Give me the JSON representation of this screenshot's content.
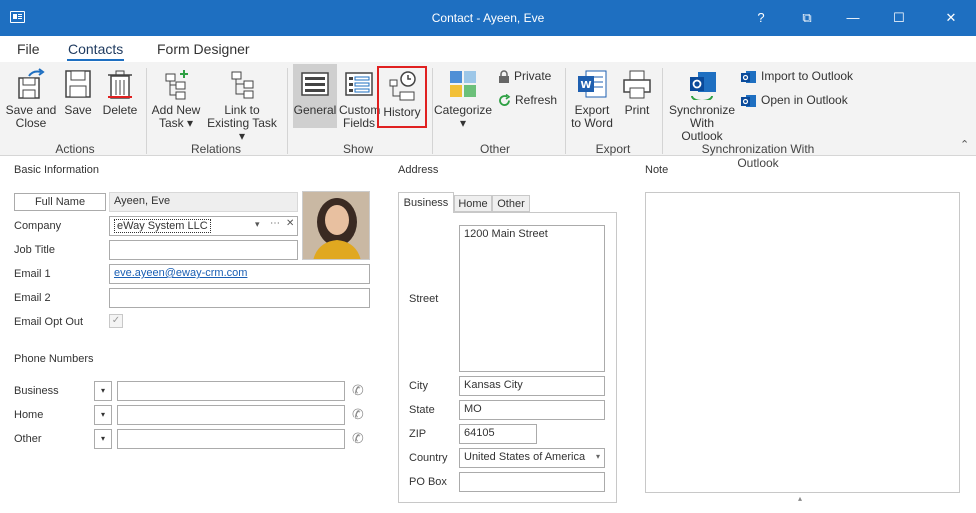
{
  "window": {
    "title": "Contact - Ayeen, Eve",
    "help_glyph": "?",
    "restore_glyph": "⧉",
    "minimize_glyph": "—",
    "maximize_glyph": "☐",
    "close_glyph": "✕"
  },
  "menu": {
    "file": "File",
    "contacts": "Contacts",
    "form_designer": "Form Designer"
  },
  "ribbon": {
    "save_and_close": [
      "Save and",
      "Close"
    ],
    "save": "Save",
    "delete": "Delete",
    "add_new_task": [
      "Add New",
      "Task ▾"
    ],
    "link_existing": [
      "Link to",
      "Existing Task ▾"
    ],
    "general": "General",
    "custom_fields": [
      "Custom",
      "Fields"
    ],
    "history": "History",
    "categorize": "Categorize",
    "private": "Private",
    "refresh": "Refresh",
    "export_word": [
      "Export",
      "to Word"
    ],
    "print": "Print",
    "sync_outlook": [
      "Synchronize",
      "With Outlook"
    ],
    "import_outlook": "Import to Outlook",
    "open_outlook": "Open in Outlook",
    "groups": {
      "actions": "Actions",
      "relations": "Relations",
      "show": "Show",
      "other": "Other",
      "export": "Export",
      "sync": "Synchronization With Outlook"
    },
    "collapse_glyph": "⌃",
    "dropdown_glyph": "▾"
  },
  "basic": {
    "section": "Basic Information",
    "full_name_btn": "Full Name",
    "full_name": "Ayeen, Eve",
    "company_label": "Company",
    "company": "eWay System LLC",
    "company_buttons": [
      "▾",
      "⋯",
      "✕"
    ],
    "job_title_label": "Job Title",
    "job_title": "",
    "email1_label": "Email 1",
    "email1": "eve.ayeen@eway-crm.com",
    "email2_label": "Email 2",
    "email2": "",
    "opt_out_label": "Email Opt Out",
    "opt_out_check": "✓"
  },
  "phones": {
    "section": "Phone Numbers",
    "items": [
      {
        "label": "Business",
        "value": ""
      },
      {
        "label": "Home",
        "value": ""
      },
      {
        "label": "Other",
        "value": ""
      }
    ],
    "dropdown_glyph": "▾",
    "phone_glyph": "✆"
  },
  "address": {
    "section": "Address",
    "tabs": [
      "Business",
      "Home",
      "Other"
    ],
    "street_label": "Street",
    "street": "1200 Main Street",
    "city_label": "City",
    "city": "Kansas City",
    "state_label": "State",
    "state": "MO",
    "zip_label": "ZIP",
    "zip": "64105",
    "country_label": "Country",
    "country": "United States of America",
    "pobox_label": "PO Box",
    "pobox": "",
    "dropdown_glyph": "▾"
  },
  "note": {
    "label": "Note",
    "value": "",
    "splitter_glyph": "▴"
  },
  "colors": {
    "titlebar": "#1e6fc1",
    "highlight_border": "#e02020",
    "general_active": "#cfcfcf"
  }
}
